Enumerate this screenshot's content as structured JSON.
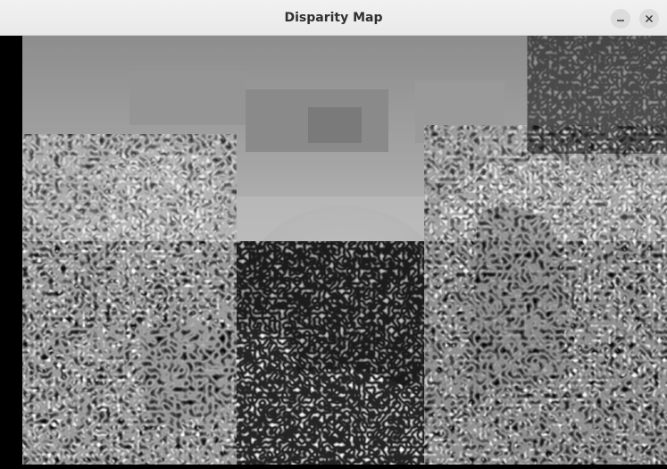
{
  "window": {
    "title": "Disparity Map"
  },
  "controls": {
    "minimize_icon": "minimize-icon",
    "close_icon": "close-icon"
  }
}
